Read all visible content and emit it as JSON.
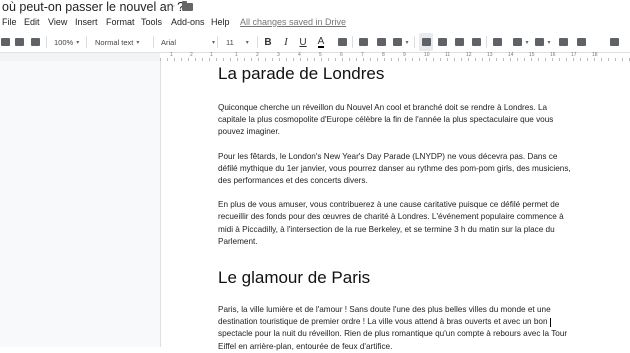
{
  "doc": {
    "title": "où peut-on passer le nouvel an ?",
    "star_icon": "star-icon",
    "folder_icon": "folder-icon"
  },
  "menu": {
    "items": [
      "File",
      "Edit",
      "View",
      "Insert",
      "Format",
      "Tools",
      "Add-ons",
      "Help"
    ],
    "saved_status": "All changes saved in Drive"
  },
  "toolbar": {
    "zoom": "100%",
    "style": "Normal text",
    "font": "Arial",
    "font_size": "11",
    "bold": "B",
    "italic": "I",
    "underline": "U",
    "text_color": "A",
    "icons": [
      "print-icon",
      "spellcheck-icon",
      "paint-format-icon",
      "highlight-icon",
      "link-icon",
      "comment-icon",
      "image-icon",
      "align-left-icon",
      "align-center-icon",
      "align-right-icon",
      "justify-icon",
      "line-spacing-icon",
      "numbered-list-icon",
      "bulleted-list-icon",
      "decrease-indent-icon",
      "increase-indent-icon",
      "clear-formatting-icon"
    ]
  },
  "ruler": {
    "numbers": [
      "1",
      "2",
      "1",
      "1",
      "2",
      "3",
      "4",
      "5",
      "6",
      "7",
      "8",
      "9",
      "10",
      "11",
      "12",
      "13",
      "14",
      "15",
      "16",
      "17",
      "18"
    ]
  },
  "content": {
    "heading1": "La parade de Londres",
    "para1": "Quiconque cherche un réveillon du Nouvel An cool et branché doit se rendre à Londres. La capitale la plus cosmopolite d'Europe célèbre la fin de l'année la plus spectaculaire que vous pouvez imaginer.",
    "para2": "Pour les fêtards, le London's New Year's Day Parade (LNYDP) ne vous décevra pas. Dans ce défilé mythique du 1er janvier, vous pourrez danser au rythme des pom-pom girls, des musiciens, des performances et des concerts divers.",
    "para3": "En plus de vous amuser, vous contribuerez à une cause caritative puisque ce défilé permet de recueillir des fonds pour des œuvres de charité à Londres. L'événement populaire commence à midi à Piccadilly, à l'intersection de la rue Berkeley, et se termine 3 h du matin sur la place du Parlement.",
    "heading2": "Le glamour de Paris",
    "para4a": "Paris, la ville lumière et de l'amour ! Sans doute l'une des plus belles villes du monde et une destination touristique de premier ordre ! La ville vous attend à bras ouverts et avec un bon",
    "para4b": "spectacle pour la nuit du réveillon. Rien de plus romantique qu'un compte à rebours avec la Tour Eiffel en arrière-plan, entourée de feux d'artifice."
  }
}
